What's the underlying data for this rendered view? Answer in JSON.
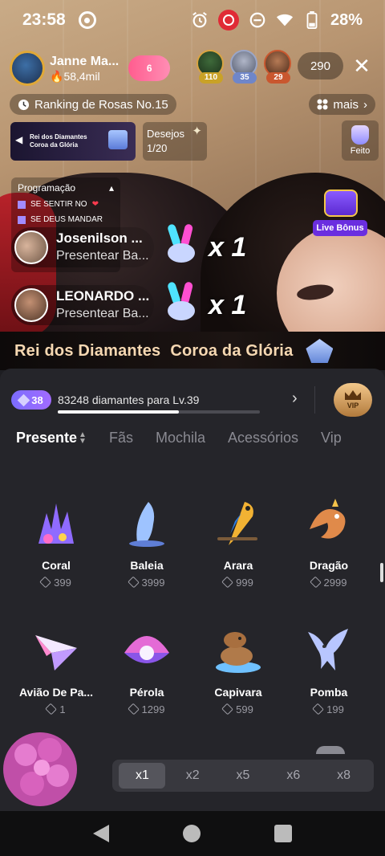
{
  "status_bar": {
    "time": "23:58",
    "battery": "28%"
  },
  "host": {
    "name": "Janne Ma...",
    "fans": "58,4mil",
    "follow_badge": "6"
  },
  "viewers": [
    {
      "level": "110",
      "color": "#c9a227"
    },
    {
      "level": "35",
      "color": "#6f86c9"
    },
    {
      "level": "29",
      "color": "#c9572f"
    }
  ],
  "viewer_count": "290",
  "ranking": "Ranking de Rosas No.15",
  "mais": "mais",
  "banner": {
    "line1": "Rei dos Diamantes",
    "line2": "Coroa da Glória"
  },
  "desejos": {
    "label": "Desejos",
    "progress": "1/20"
  },
  "feito": "Feito",
  "programacao": {
    "title": "Programação",
    "items": [
      "SE SENTIR NO",
      "SE DEUS MANDAR"
    ]
  },
  "live_bonus": "Live Bônus",
  "gift_notifications": [
    {
      "name": "Josenilson ...",
      "action": "Presentear Ba...",
      "multiplier": "x 1"
    },
    {
      "name": "LEONARDO ...",
      "action": "Presentear Ba...",
      "multiplier": "x 1"
    }
  ],
  "promo": {
    "left": "Rei dos Diamantes",
    "right": "Coroa da Glória"
  },
  "level": {
    "badge": "38",
    "text": "83248 diamantes para Lv.39",
    "progress_fraction": 0.6,
    "vip_label": "VIP"
  },
  "tabs": [
    {
      "label": "Presente",
      "active": true
    },
    {
      "label": "Fãs",
      "active": false
    },
    {
      "label": "Mochila",
      "active": false
    },
    {
      "label": "Acessórios",
      "active": false
    },
    {
      "label": "Vip",
      "active": false
    }
  ],
  "gifts": [
    {
      "name": "Coral",
      "price": "399",
      "icon": "coral-icon"
    },
    {
      "name": "Baleia",
      "price": "3999",
      "icon": "whale-icon"
    },
    {
      "name": "Arara",
      "price": "999",
      "icon": "macaw-icon"
    },
    {
      "name": "Dragão",
      "price": "2999",
      "icon": "dragon-icon"
    },
    {
      "name": "Avião De Pa...",
      "price": "1",
      "icon": "paper-plane-icon"
    },
    {
      "name": "Pérola",
      "price": "1299",
      "icon": "pearl-icon"
    },
    {
      "name": "Capivara",
      "price": "599",
      "icon": "capybara-icon"
    },
    {
      "name": "Pomba",
      "price": "199",
      "icon": "dove-icon"
    }
  ],
  "multipliers": [
    "x1",
    "x2",
    "x5",
    "x6",
    "x8"
  ],
  "selected_multiplier": "x1"
}
